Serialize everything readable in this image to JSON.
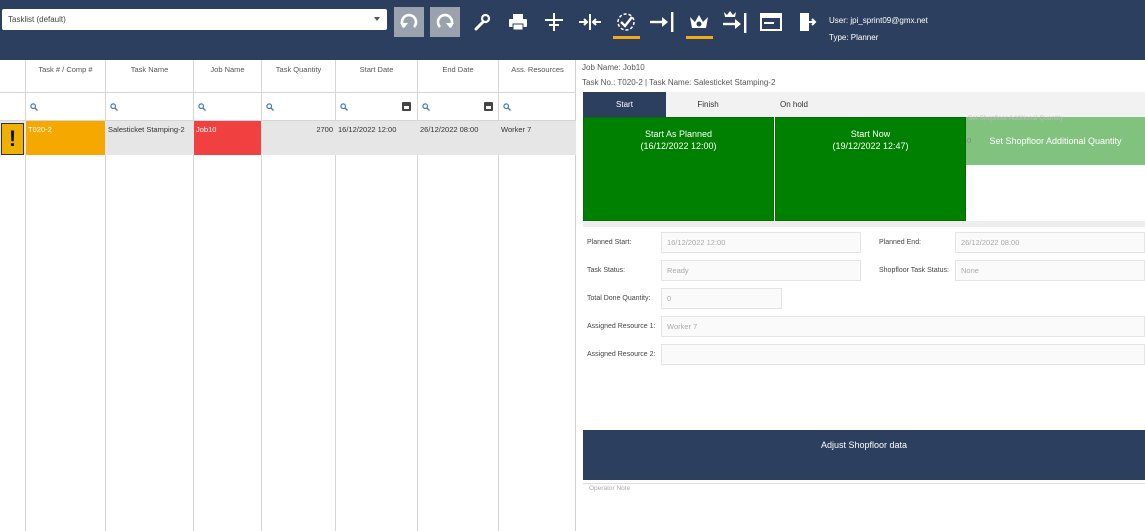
{
  "toolbar": {
    "tasklist_value": "Tasklist (default)",
    "icons": [
      "undo-icon",
      "redo-icon",
      "wrench-icon",
      "print-icon",
      "split-icon",
      "merge-icon",
      "check-icon",
      "arrow-bar-icon",
      "crown-icon",
      "crown-arrow-icon",
      "window-icon",
      "door-exit-icon"
    ],
    "accent_color": "#f2a91a",
    "background_color": "#2c3f5e"
  },
  "user": {
    "user_line": "User: jpi_sprint09@gmx.net",
    "type_line": "Type: Planner"
  },
  "grid": {
    "columns": [
      "Task # / Comp #",
      "Task Name",
      "Job Name",
      "Task Quantity",
      "Start Date",
      "End Date",
      "Ass. Resources"
    ],
    "rows": [
      {
        "warning": "!",
        "task_no": "T020-2",
        "task_name": "Salesticket Stamping-2",
        "job_name": "Job10",
        "quantity": "2700",
        "start_date": "16/12/2022 12:00",
        "end_date": "26/12/2022 08:00",
        "resources": "Worker 7"
      }
    ]
  },
  "detail": {
    "job_name": "Job Name: Job10",
    "task_info": "Task No.: T020-2 | Task Name: Salesticket Stamping-2",
    "tabs": [
      "Start",
      "Finish",
      "On hold"
    ],
    "start_as_planned": "Start As Planned",
    "start_as_planned_date": "(16/12/2022 12:00)",
    "start_now": "Start Now",
    "start_now_date": "(19/12/2022 12:47)",
    "set_qty_button": "Set Shopfloor Additional Quantity",
    "set_qty_label": "Set Shopfloor Additional Quantity",
    "set_qty_value": "0",
    "fields": {
      "planned_start_label": "Planned Start:",
      "planned_start_value": "16/12/2022 12:00",
      "planned_end_label": "Planned End:",
      "planned_end_value": "26/12/2022 08:00",
      "task_status_label": "Task Status:",
      "task_status_value": "Ready",
      "shopfloor_status_label": "Shopfloor Task Status:",
      "shopfloor_status_value": "None",
      "total_done_label": "Total Done Quantity:",
      "total_done_value": "0",
      "assigned1_label": "Assigned Resource 1:",
      "assigned1_value": "Worker 7",
      "assigned2_label": "Assigned Resource 2:",
      "assigned2_value": ""
    },
    "adjust_button": "Adjust Shopfloor data",
    "operator_note_label": "Operator Note"
  }
}
